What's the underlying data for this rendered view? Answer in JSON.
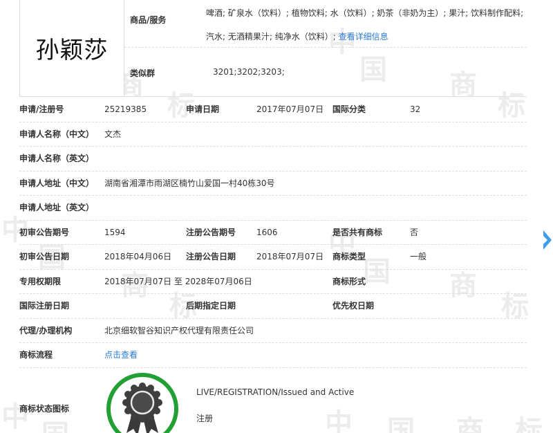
{
  "trademark": {
    "name_image_text": "孙颖莎",
    "goods_label": "商品/服务",
    "goods_text": "啤酒; 矿泉水（饮料）; 植物饮料; 水（饮料）; 奶茶（非奶为主）; 果汁; 饮料制作配料; 汽水; 无酒精果汁; 纯净水（饮料）;",
    "goods_more_link": "查看详细信息",
    "similar_group_label": "类似群",
    "similar_group_value": "3201;3202;3203;"
  },
  "rows": {
    "reg_no_label": "申请/注册号",
    "reg_no": "25219385",
    "apply_date_label": "申请日期",
    "apply_date": "2017年07月07日",
    "intl_class_label": "国际分类",
    "intl_class": "32",
    "applicant_cn_label": "申请人名称（中文）",
    "applicant_cn": "文杰",
    "applicant_en_label": "申请人名称（英文）",
    "address_cn_label": "申请人地址（中文）",
    "address_cn": "湖南省湘潭市雨湖区楠竹山爱国一村40栋30号",
    "address_en_label": "申请人地址（英文）",
    "prelim_no_label": "初审公告期号",
    "prelim_no": "1594",
    "reg_ann_no_label": "注册公告期号",
    "reg_ann_no": "1606",
    "shared_label": "是否共有商标",
    "shared": "否",
    "prelim_date_label": "初审公告日期",
    "prelim_date": "2018年04月06日",
    "reg_ann_date_label": "注册公告日期",
    "reg_ann_date": "2018年07月07日",
    "type_label": "商标类型",
    "type": "一般",
    "exclusive_label": "专用权期限",
    "exclusive": "2018年07月07日 至 2028年07月06日",
    "form_label": "商标形式",
    "intl_reg_date_label": "国际注册日期",
    "later_date_label": "后期指定日期",
    "priority_date_label": "优先权日期",
    "agent_label": "代理/办理机构",
    "agent": "北京细软智谷知识产权代理有限责任公司",
    "flow_label": "商标流程",
    "flow_link": "点击查看"
  },
  "status": {
    "label": "商标状态图标",
    "en": "LIVE/REGISTRATION/Issued and Active",
    "cn": "注册",
    "badge_color": "#22a033"
  },
  "watermark_chars": [
    "中",
    "国",
    "商",
    "标"
  ],
  "colors": {
    "link": "#2b7bd6",
    "nav_arrow": "#3d9be9",
    "badge_ring": "#22a033"
  }
}
